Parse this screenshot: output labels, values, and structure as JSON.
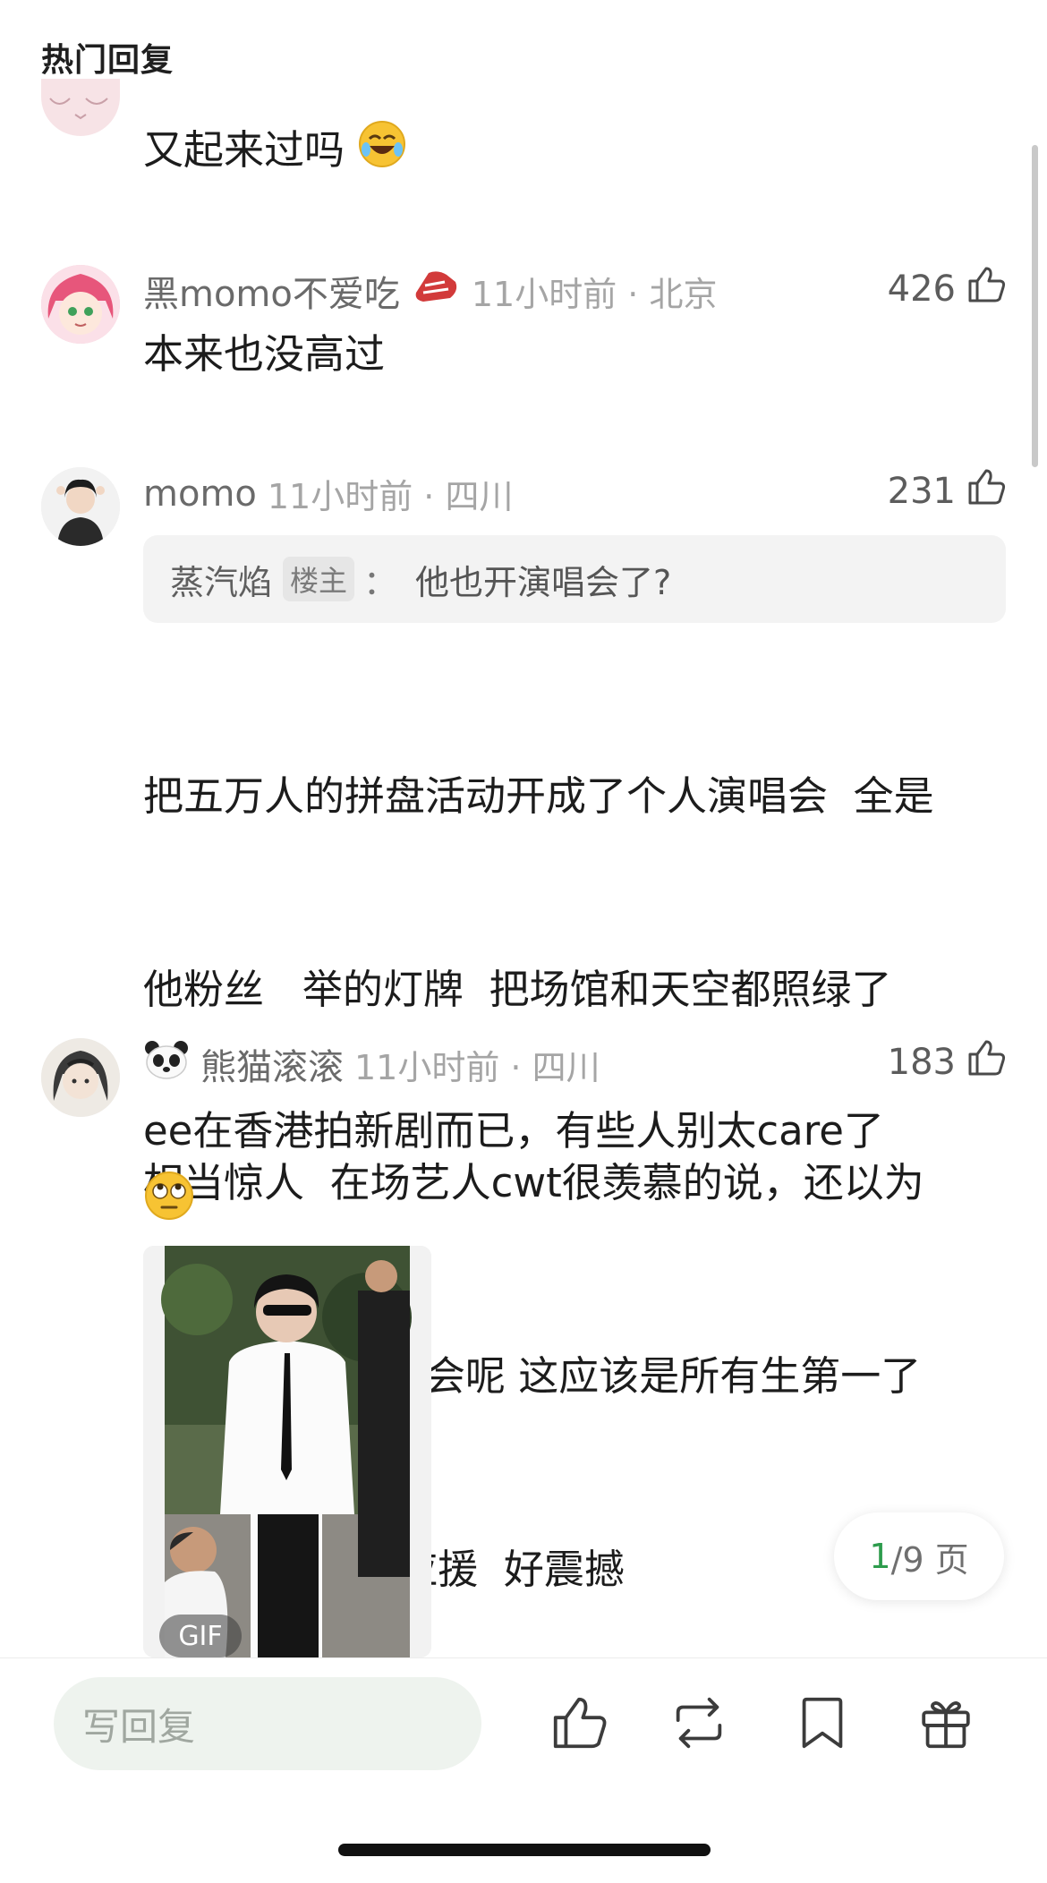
{
  "header": {
    "title": "热门回复"
  },
  "comments": [
    {
      "text": "又起来过吗"
    },
    {
      "username": "黑momo不爱吃",
      "time_location": "11小时前 · 北京",
      "likes": "426",
      "text": "本来也没高过"
    },
    {
      "username": "momo",
      "time_location": "11小时前 · 四川",
      "likes": "231",
      "quote": {
        "name": "蒸汽焰",
        "badge": "楼主",
        "separator": "：",
        "text": "他也开演唱会了?"
      },
      "lines": [
        "把五万人的拼盘活动开成了个人演唱会  全是",
        "他粉丝   举的灯牌  把场馆和天空都照绿了",
        "相当惊人  在场艺人cwt很羡慕的说，还以为",
        "来到了成毅演唱会呢 这应该是所有生第一了",
        "吧 现象级别的应援  好震撼"
      ]
    },
    {
      "username": "熊猫滚滚",
      "time_location": "11小时前 · 四川",
      "likes": "183",
      "text": "ee在香港拍新剧而已，有些人别太care了",
      "gif_label": "GIF"
    }
  ],
  "pager": {
    "current": "1",
    "total_text": "/9 页"
  },
  "bottom_bar": {
    "reply_placeholder": "写回复",
    "icons": [
      "like-icon",
      "repost-icon",
      "bookmark-icon",
      "gift-icon"
    ]
  },
  "colors": {
    "accent_green": "#2e9c4d",
    "text_gray": "#7b7b7b"
  }
}
